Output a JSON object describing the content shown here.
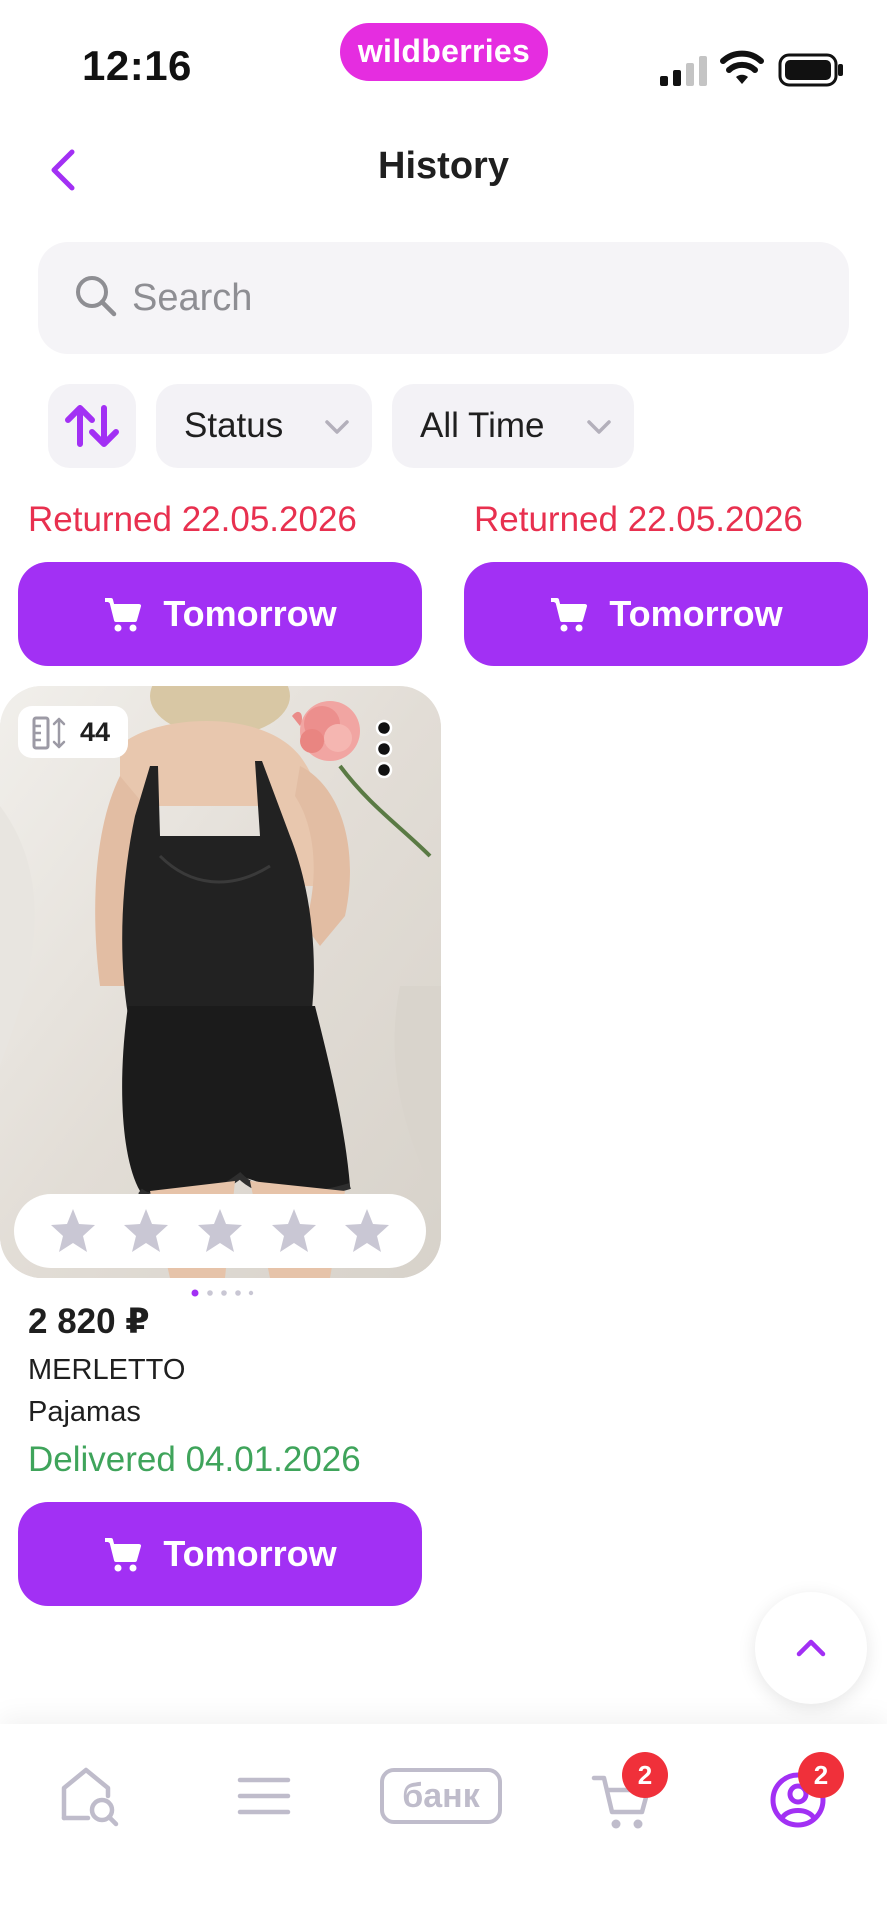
{
  "status_bar": {
    "time": "12:16",
    "brand": "wildberries",
    "icons": [
      "cellular-signal-icon",
      "wifi-icon",
      "battery-icon"
    ]
  },
  "header": {
    "title": "History",
    "back_icon": "chevron-left-icon"
  },
  "search": {
    "placeholder": "Search",
    "value": ""
  },
  "filters": {
    "sort_icon": "sort-arrows-icon",
    "status_label": "Status",
    "time_label": "All Time"
  },
  "orders": [
    {
      "status": "Returned 22.05.2026",
      "button_label": "Tomorrow"
    },
    {
      "status": "Returned 22.05.2026",
      "button_label": "Tomorrow"
    },
    {
      "size": "44",
      "rating_stars": 5,
      "rating_value": 0,
      "price": "2 820 ₽",
      "brand": "MERLETTO",
      "name": "Pajamas",
      "status": "Delivered 04.01.2026",
      "button_label": "Tomorrow",
      "image_count": 5,
      "image_index": 1
    }
  ],
  "bottom_nav": {
    "items": [
      {
        "name": "home-search",
        "icon": "home-search-icon"
      },
      {
        "name": "catalog",
        "icon": "menu-icon"
      },
      {
        "name": "bank",
        "label": "банк"
      },
      {
        "name": "cart",
        "icon": "cart-icon",
        "badge": "2"
      },
      {
        "name": "profile",
        "icon": "profile-icon",
        "badge": "2"
      }
    ]
  },
  "colors": {
    "accent": "#a230f4",
    "brand_pink": "#e52de0",
    "returned": "#e8304f",
    "delivered": "#3fa45b",
    "badge": "#f0303a"
  }
}
